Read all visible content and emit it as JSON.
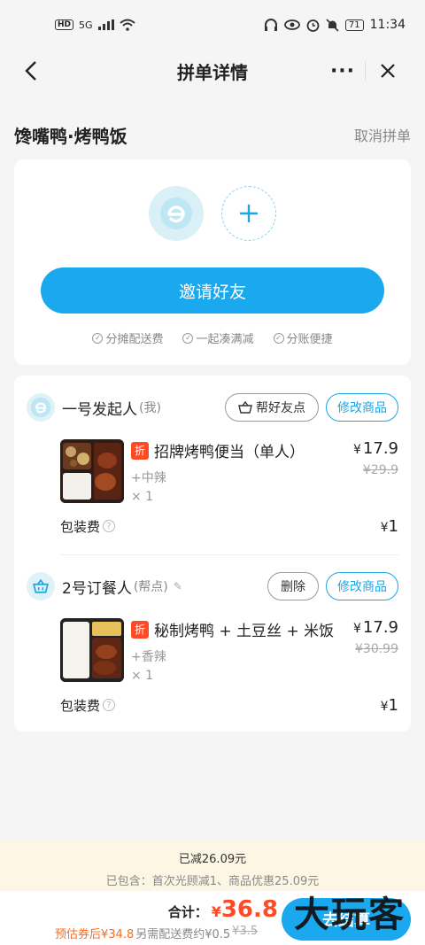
{
  "status_bar": {
    "left": [
      "HD",
      "5G"
    ],
    "time": "11:34",
    "battery": "71"
  },
  "nav": {
    "title": "拼单详情",
    "more": "···"
  },
  "shop": {
    "name": "馋嘴鸭·烤鸭饭",
    "cancel": "取消拼单"
  },
  "invite": {
    "button": "邀请好友",
    "features": [
      "分摊配送费",
      "一起凑满减",
      "分账便捷"
    ]
  },
  "orders": [
    {
      "name": "一号发起人",
      "tag": "(我)",
      "action": "帮好友点",
      "edit": "修改商品",
      "item": {
        "badge": "折",
        "title": "招牌烤鸭便当（单人）",
        "spec": "+中辣",
        "qty": "× 1",
        "price": "17.9",
        "old_price": "¥29.9"
      },
      "pack_label": "包装费",
      "pack_price": "1"
    },
    {
      "name": "2号订餐人",
      "tag": "(帮点)",
      "action": "删除",
      "edit": "修改商品",
      "item": {
        "badge": "折",
        "title": "秘制烤鸭 + 土豆丝 + 米饭",
        "spec": "+香辣",
        "qty": "× 1",
        "price": "17.9",
        "old_price": "¥30.99"
      },
      "pack_label": "包装费",
      "pack_price": "1"
    }
  ],
  "summary": {
    "discount": "已减26.09元",
    "detail": "已包含：首次光顾减1、商品优惠25.09元"
  },
  "bottom": {
    "total_label": "合计：",
    "yen": "¥",
    "total": "36.8",
    "coupon": "预估券后¥34.8",
    "extra": "另需配送费约¥0.5",
    "extra_old": "¥3.5",
    "pay": "去结算",
    "watermark": "大玩客"
  },
  "colors": {
    "accent": "#1aa8ef",
    "price_red": "#ff4a26"
  }
}
